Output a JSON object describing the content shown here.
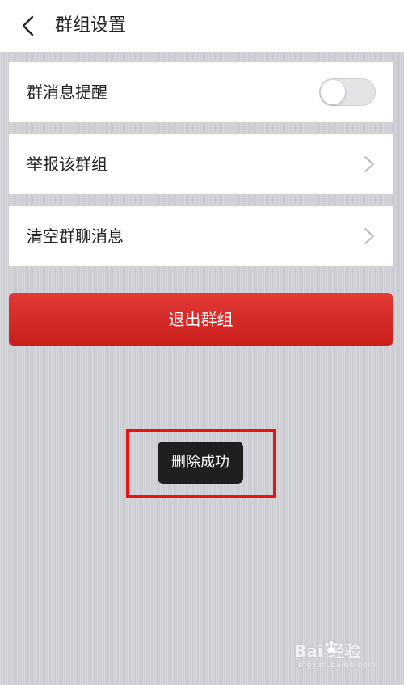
{
  "header": {
    "title": "群组设置",
    "back_icon": "chevron-left-icon"
  },
  "settings": {
    "items": [
      {
        "label": "群消息提醒",
        "control": "toggle",
        "toggle_on": false
      },
      {
        "label": "举报该群组",
        "control": "chevron-right-icon"
      },
      {
        "label": "清空群聊消息",
        "control": "chevron-right-icon"
      }
    ]
  },
  "exit_button": {
    "label": "退出群组",
    "color": "#d62a27"
  },
  "toast": {
    "message": "删除成功"
  },
  "annotation": {
    "color": "#ee1111"
  },
  "watermark": {
    "brand": "Bai 经验",
    "url": "jingyan.baidu.com"
  }
}
